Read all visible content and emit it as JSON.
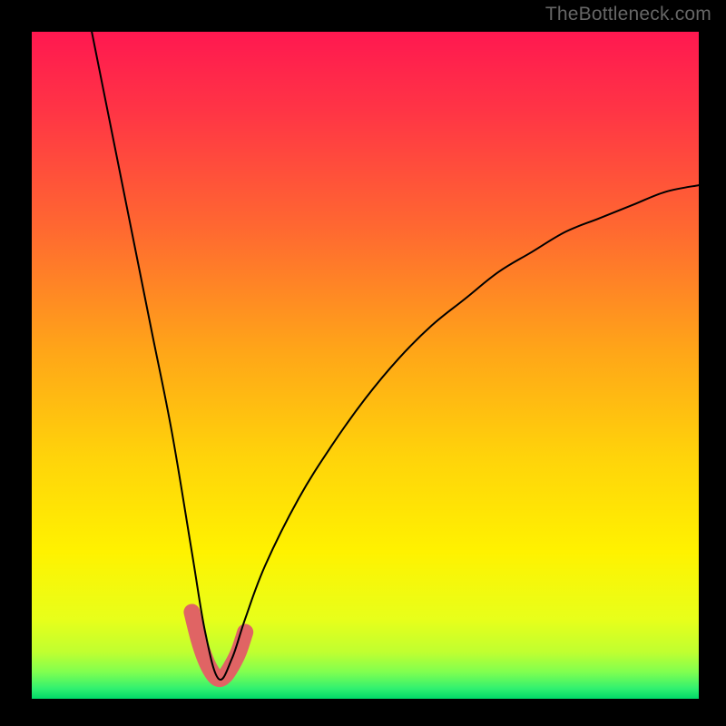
{
  "watermark": "TheBottleneck.com",
  "chart_data": {
    "type": "line",
    "title": "",
    "xlabel": "",
    "ylabel": "",
    "xlim": [
      0,
      100
    ],
    "ylim": [
      0,
      100
    ],
    "grid": false,
    "legend": false,
    "notes": "Background is a vertical rainbow gradient (red top → green bottom). A thin black curve descends steeply from top-left, reaches a minimum near x≈28 y≈3, then rises more gently toward upper-right (~y≈77 at x=100). A thick salmon marker highlights the valley segment.",
    "series": [
      {
        "name": "curve",
        "x": [
          9,
          12,
          15,
          18,
          21,
          24,
          26,
          28,
          30,
          32,
          35,
          40,
          45,
          50,
          55,
          60,
          65,
          70,
          75,
          80,
          85,
          90,
          95,
          100
        ],
        "values": [
          100,
          85,
          70,
          55,
          40,
          22,
          10,
          3,
          6,
          12,
          20,
          30,
          38,
          45,
          51,
          56,
          60,
          64,
          67,
          70,
          72,
          74,
          76,
          77
        ]
      },
      {
        "name": "valley-highlight",
        "x": [
          24,
          25,
          26,
          27,
          28,
          29,
          30,
          31,
          32
        ],
        "values": [
          13,
          9,
          6,
          4,
          3,
          3.5,
          5,
          7,
          10
        ]
      }
    ],
    "background_gradient_stops": [
      {
        "offset": 0.0,
        "color": "#ff1850"
      },
      {
        "offset": 0.12,
        "color": "#ff3545"
      },
      {
        "offset": 0.3,
        "color": "#ff6a30"
      },
      {
        "offset": 0.48,
        "color": "#ffa618"
      },
      {
        "offset": 0.64,
        "color": "#ffd40a"
      },
      {
        "offset": 0.78,
        "color": "#fff200"
      },
      {
        "offset": 0.88,
        "color": "#e8ff1a"
      },
      {
        "offset": 0.93,
        "color": "#c0ff30"
      },
      {
        "offset": 0.96,
        "color": "#80ff50"
      },
      {
        "offset": 0.985,
        "color": "#30f070"
      },
      {
        "offset": 1.0,
        "color": "#00d868"
      }
    ],
    "colors": {
      "curve_stroke": "#000000",
      "valley_stroke": "#e06464",
      "frame": "#000000"
    }
  }
}
